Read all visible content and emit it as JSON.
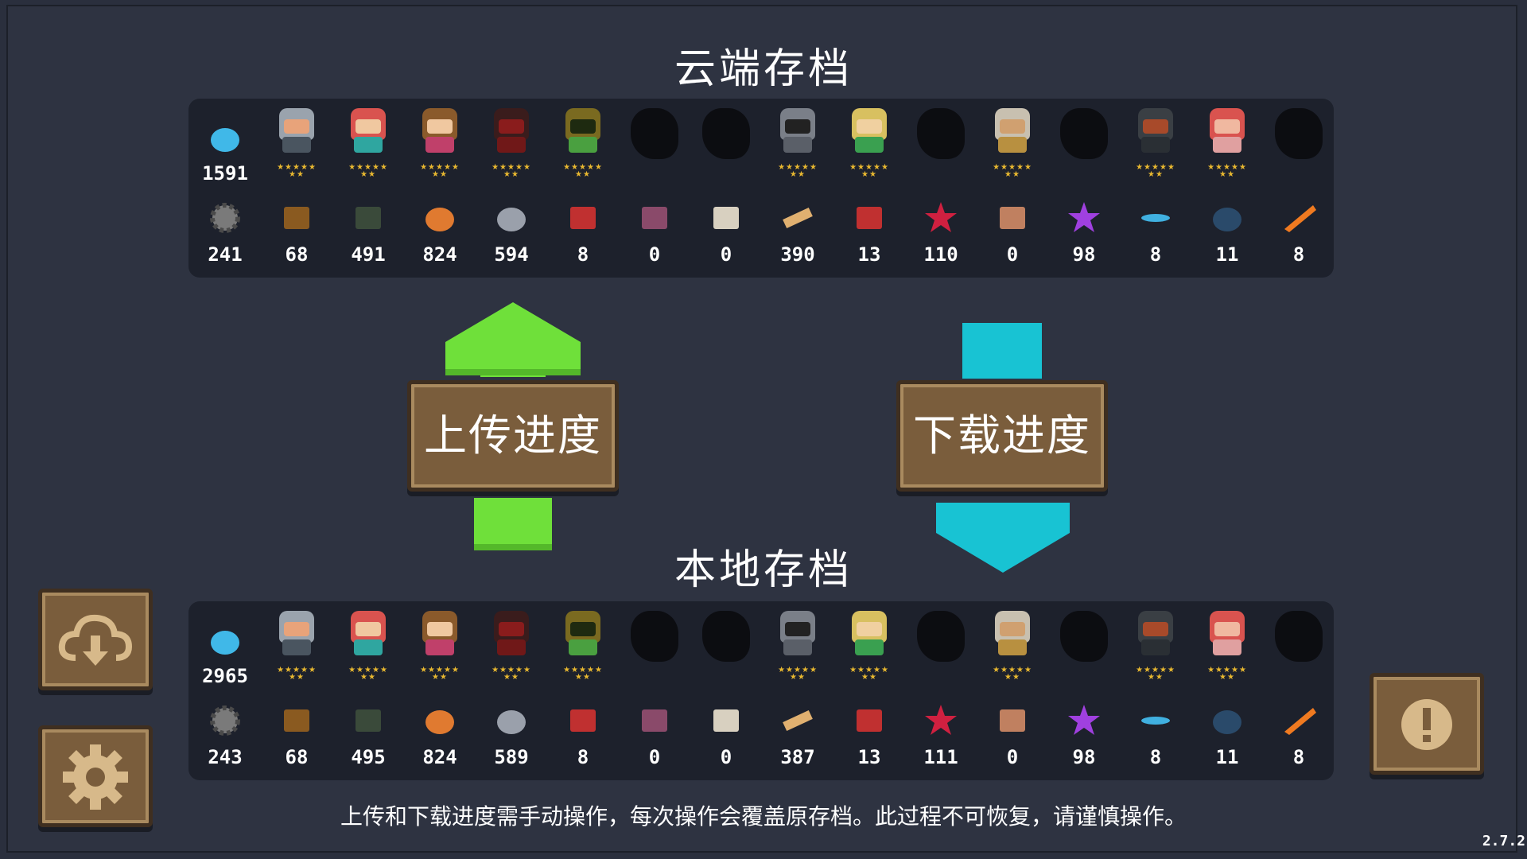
{
  "cloud": {
    "title": "云端存档",
    "gems": "1591",
    "materials": [
      "241",
      "68",
      "491",
      "824",
      "594",
      "8",
      "0",
      "0",
      "390",
      "13",
      "110",
      "0",
      "98",
      "8",
      "11",
      "8"
    ]
  },
  "local": {
    "title": "本地存档",
    "gems": "2965",
    "materials": [
      "243",
      "68",
      "495",
      "824",
      "589",
      "8",
      "0",
      "0",
      "387",
      "13",
      "111",
      "0",
      "98",
      "8",
      "11",
      "8"
    ]
  },
  "buttons": {
    "upload": "上传进度",
    "download": "下载进度"
  },
  "stars": "★★★★★\n★★",
  "icons": {
    "gem": "blue-gem-icon",
    "materials": [
      "gear-part-icon",
      "hammer-icon",
      "battery-icon",
      "ore-icon",
      "stone-icon",
      "gun-part-icon",
      "totem-icon",
      "scroll-icon",
      "wood-plank-icon",
      "chip-icon",
      "red-leaf-icon",
      "jar-icon",
      "purple-crystal-icon",
      "blue-feather-icon",
      "fish-icon",
      "carrot-icon"
    ]
  },
  "colors": {
    "background": "#2e3341",
    "panel": "#1d212c",
    "button": "#7a5d3c",
    "upload_arrow": "#6fe03a",
    "download_arrow": "#18c3d3"
  },
  "note": "上传和下载进度需手动操作，每次操作会覆盖原存档。此过程不可恢复，请谨慎操作。",
  "version": "2.7.2"
}
